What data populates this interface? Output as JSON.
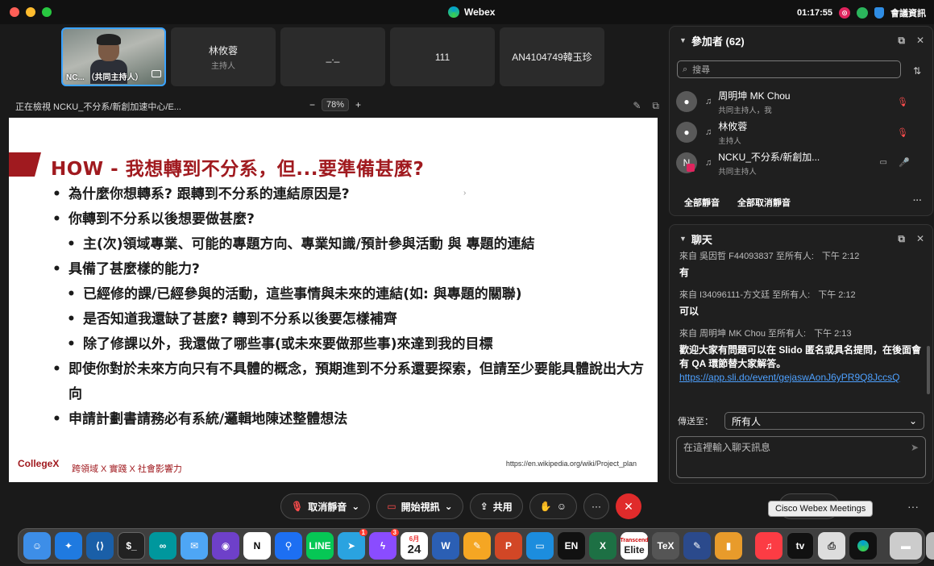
{
  "menubar": {
    "app_name": "Webex",
    "clock": "01:17:55",
    "meeting_info": "會議資訊"
  },
  "video_tiles": [
    {
      "name": "NC... （共同主持人）",
      "role": "",
      "has_video": true
    },
    {
      "name": "林攸蓉",
      "role": "主持人"
    },
    {
      "name": "_._",
      "role": ""
    },
    {
      "name": "111",
      "role": ""
    },
    {
      "name": "AN4104749韓玉珍",
      "role": ""
    }
  ],
  "share_bar": {
    "viewing": "正在檢視 NCKU_不分系/新創加速中心/E...",
    "zoom": "78%",
    "zoom_out": "−",
    "zoom_in": "+"
  },
  "slide": {
    "title": "HOW - 我想轉到不分系，但...要準備甚麼?",
    "bullets": [
      {
        "text": "為什麼你想轉系? 跟轉到不分系的連結原因是?",
        "level": 1
      },
      {
        "text": "你轉到不分系以後想要做甚麼?",
        "level": 1
      },
      {
        "text": "主(次)領域專業、可能的專題方向、專業知識/預計參與活動 與 專題的連結",
        "level": 2
      },
      {
        "text": "具備了甚麼樣的能力?",
        "level": 1
      },
      {
        "text": "已經修的課/已經參與的活動，這些事情與未來的連結(如: 與專題的關聯)",
        "level": 2
      },
      {
        "text": "是否知道我還缺了甚麼? 轉到不分系以後要怎樣補齊",
        "level": 2
      },
      {
        "text": "除了修課以外，我還做了哪些事(或未來要做那些事)來達到我的目標",
        "level": 2
      },
      {
        "text": "即使你對於未來方向只有不具體的概念，預期進到不分系還要探索，但請至少要能具體說出大方向",
        "level": 1
      },
      {
        "text": "申請計劃書請務必有系統/邏輯地陳述整體想法",
        "level": 1
      }
    ],
    "footer_logo": "CollegeX",
    "footer_tagline": "跨領域 X 實踐 X 社會影響力",
    "footer_source": "https://en.wikipedia.org/wiki/Project_plan"
  },
  "participants": {
    "title": "參加者 (62)",
    "search_placeholder": "搜尋",
    "list": [
      {
        "initial": "",
        "name": "周明坤 MK Chou",
        "role": "共同主持人，我",
        "mic": "muted"
      },
      {
        "initial": "",
        "name": "林攸蓉",
        "role": "主持人",
        "mic": "muted"
      },
      {
        "initial": "N",
        "name": "NCKU_不分系/新創加...",
        "role": "共同主持人",
        "mic": "on"
      }
    ],
    "mute_all": "全部靜音",
    "unmute_all": "全部取消靜音"
  },
  "chat": {
    "title": "聊天",
    "messages": [
      {
        "from": "來自 吳因哲 F44093837 至所有人:",
        "time": "下午 2:12",
        "body": "有",
        "link": ""
      },
      {
        "from": "來自 I34096111-方文廷 至所有人:",
        "time": "下午 2:12",
        "body": "可以",
        "link": ""
      },
      {
        "from": "來自 周明坤 MK Chou 至所有人:",
        "time": "下午 2:13",
        "body": "歡迎大家有問題可以在 Slido 匿名或具名提問，在後面會有 QA 環節替大家解答。",
        "link": "https://app.sli.do/event/gejaswAonJ6yPR9Q8JccsQ"
      }
    ],
    "send_to_label": "傳送至：",
    "send_to_value": "所有人",
    "input_placeholder": "在這裡輸入聊天訊息"
  },
  "controls": {
    "unmute": "取消靜音",
    "start_video": "開始視訊",
    "share": "共用",
    "chat_partial": "天",
    "tooltip": "Cisco Webex Meetings"
  },
  "dock": {
    "calendar_month": "6月",
    "calendar_day": "24",
    "badge_telegram": "1",
    "badge_messenger": "3",
    "transcend_label": "Transcend",
    "elite_label": "Elite",
    "en_label": "EN"
  }
}
